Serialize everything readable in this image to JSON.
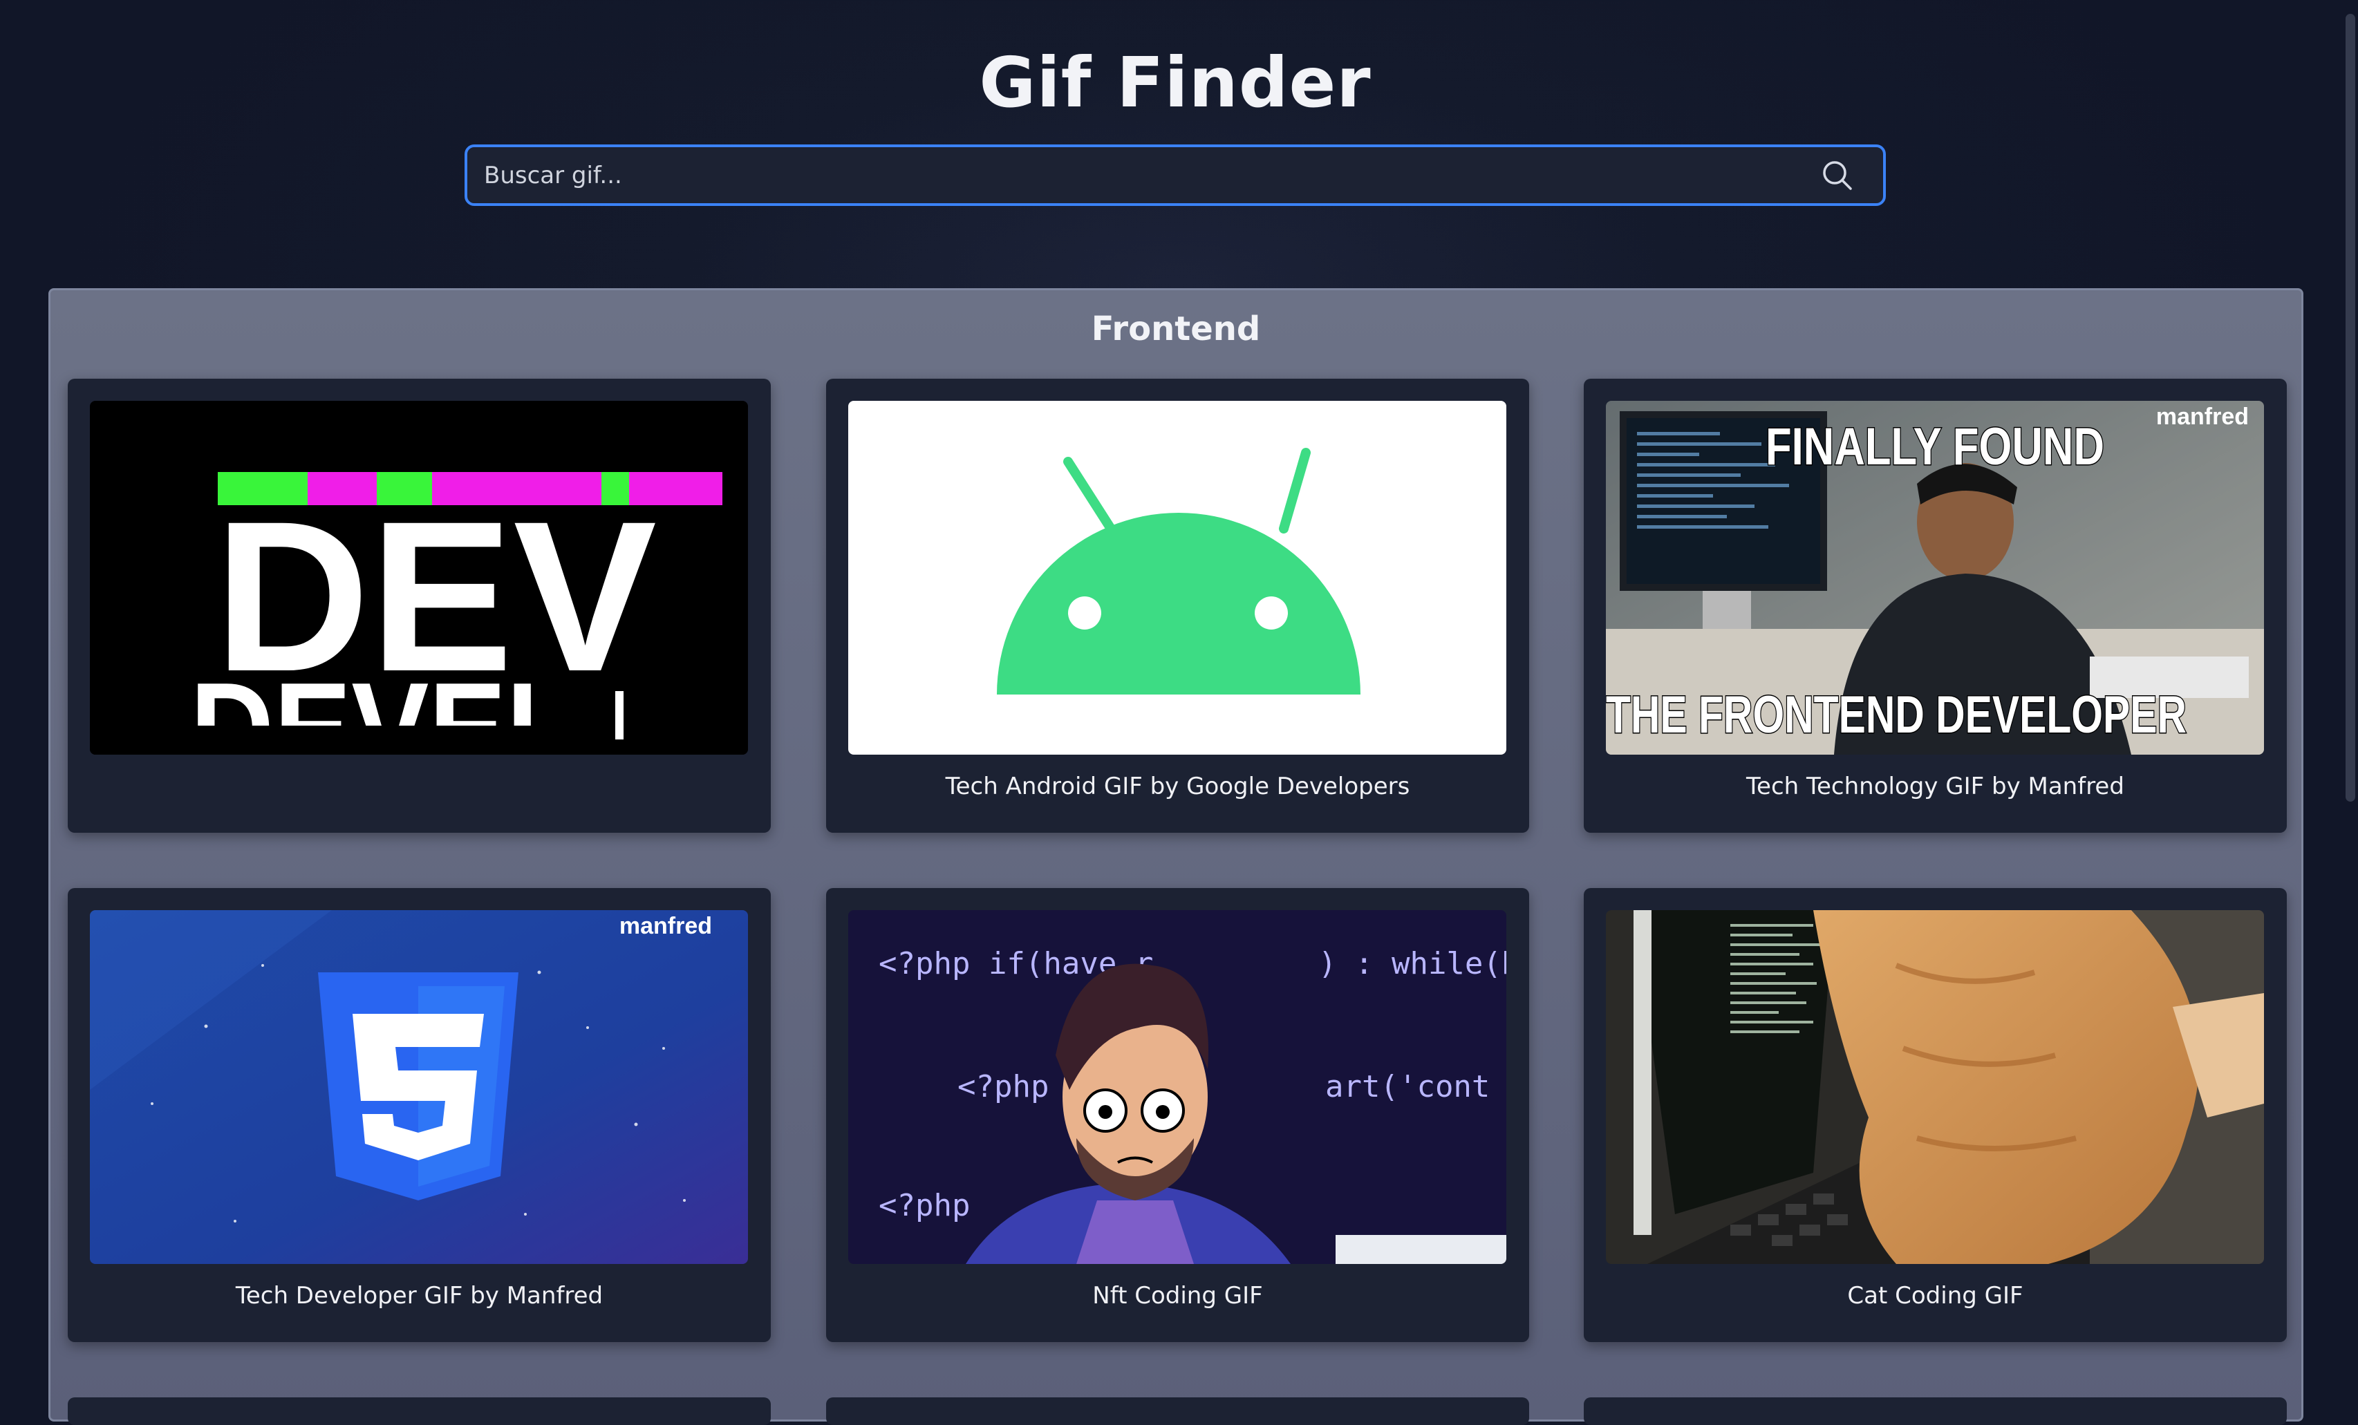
{
  "app": {
    "title": "Gif Finder"
  },
  "search": {
    "placeholder": "Buscar gif...",
    "value": "",
    "icon": "search-icon"
  },
  "section": {
    "title": "Frontend"
  },
  "gifs": [
    {
      "title": "",
      "thumbnail": "dev-glitch-text"
    },
    {
      "title": "Tech Android GIF by Google Developers",
      "thumbnail": "android-head"
    },
    {
      "title": "Tech Technology GIF by Manfred",
      "thumbnail": "frontend-developer-meme",
      "overlay_top": "FINALLY FOUND",
      "overlay_bottom": "THE FRONTEND DEVELOPER",
      "watermark": "manfred"
    },
    {
      "title": "Tech Developer GIF by Manfred",
      "thumbnail": "css3-logo",
      "watermark": "manfred"
    },
    {
      "title": "Nft Coding GIF",
      "thumbnail": "php-coder-cartoon",
      "code_lines": [
        "<?php if(have_r",
        ") : while(ha",
        "<?php ge",
        "art('cont",
        "<?php"
      ]
    },
    {
      "title": "Cat Coding GIF",
      "thumbnail": "cat-on-laptop"
    }
  ],
  "colors": {
    "accent": "#3b82f6",
    "card_bg": "#1c2233",
    "section_bg": "#646a80",
    "android_green": "#3ddc84",
    "css_blue": "#2965f1"
  }
}
